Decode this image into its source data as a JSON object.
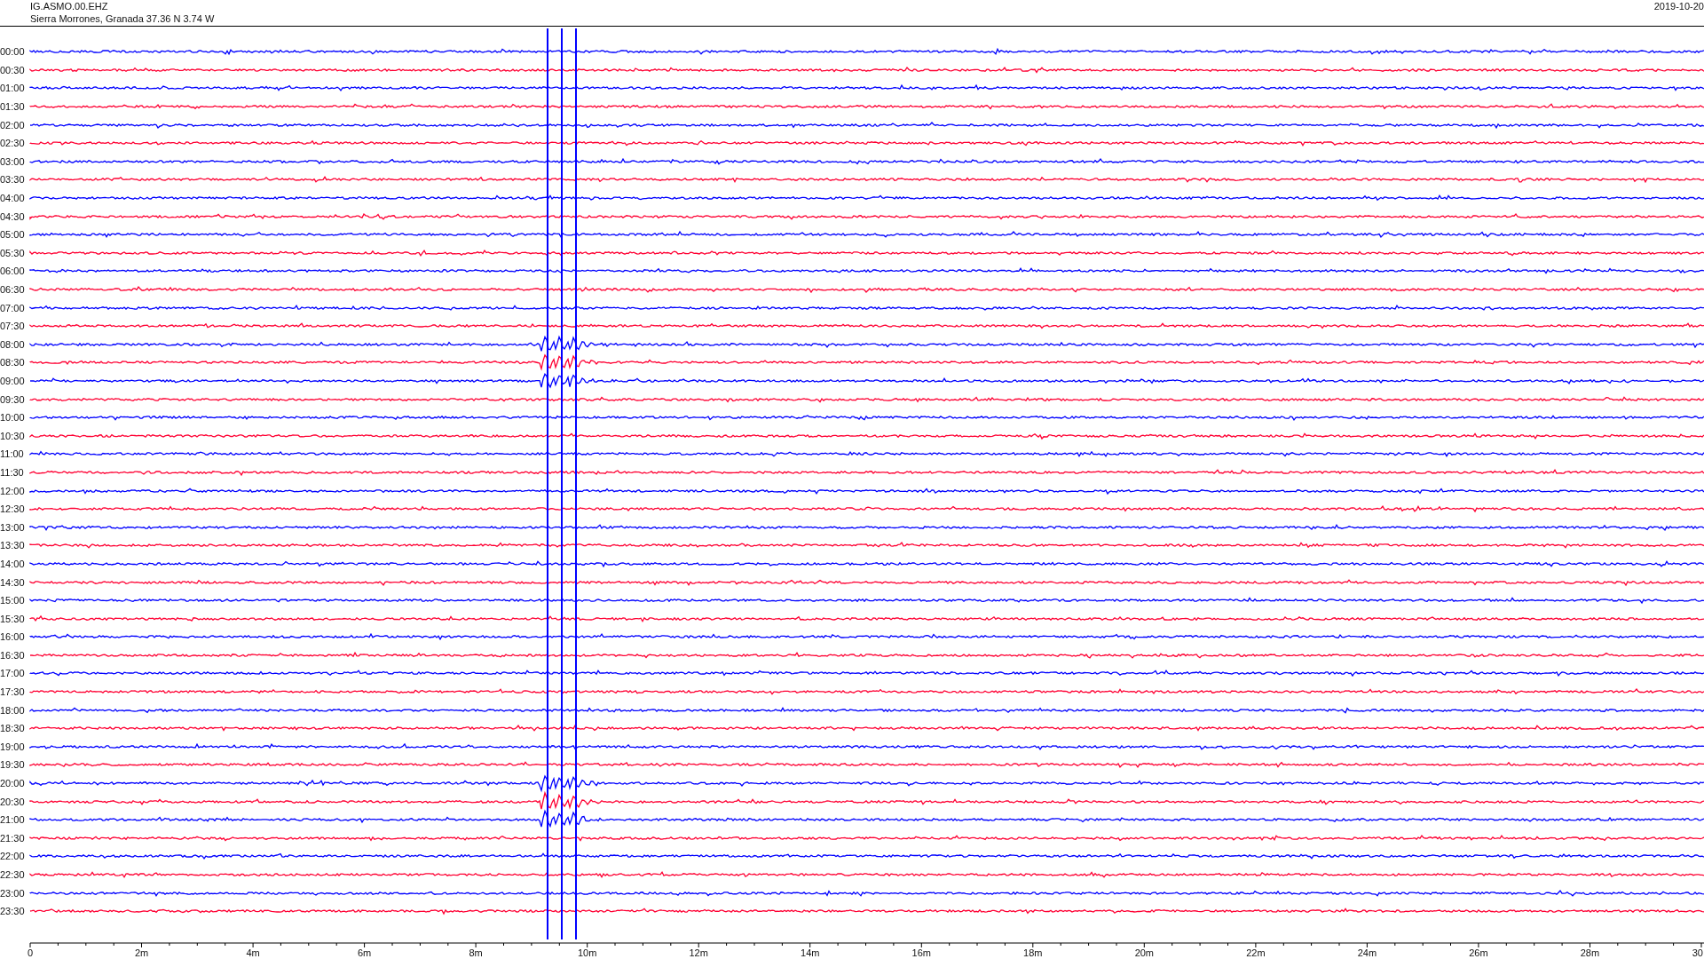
{
  "header": {
    "station": "IG.ASMO.00.EHZ",
    "location": "Sierra Morrones, Granada  37.36 N 3.74 W",
    "date": "2019-10-20"
  },
  "rows": [
    {
      "time": "00:00",
      "color": "#0000ff"
    },
    {
      "time": "00:30",
      "color": "#ff0033"
    },
    {
      "time": "01:00",
      "color": "#0000ff"
    },
    {
      "time": "01:30",
      "color": "#ff0033"
    },
    {
      "time": "02:00",
      "color": "#0000ff"
    },
    {
      "time": "02:30",
      "color": "#ff0033"
    },
    {
      "time": "03:00",
      "color": "#0000ff"
    },
    {
      "time": "03:30",
      "color": "#ff0033"
    },
    {
      "time": "04:00",
      "color": "#0000ff"
    },
    {
      "time": "04:30",
      "color": "#ff0033"
    },
    {
      "time": "05:00",
      "color": "#0000ff"
    },
    {
      "time": "05:30",
      "color": "#ff0033"
    },
    {
      "time": "06:00",
      "color": "#0000ff"
    },
    {
      "time": "06:30",
      "color": "#ff0033"
    },
    {
      "time": "07:00",
      "color": "#0000ff"
    },
    {
      "time": "07:30",
      "color": "#ff0033"
    },
    {
      "time": "08:00",
      "color": "#0000ff"
    },
    {
      "time": "08:30",
      "color": "#ff0033"
    },
    {
      "time": "09:00",
      "color": "#0000ff"
    },
    {
      "time": "09:30",
      "color": "#ff0033"
    },
    {
      "time": "10:00",
      "color": "#0000ff"
    },
    {
      "time": "10:30",
      "color": "#ff0033"
    },
    {
      "time": "11:00",
      "color": "#0000ff"
    },
    {
      "time": "11:30",
      "color": "#ff0033"
    },
    {
      "time": "12:00",
      "color": "#0000ff"
    },
    {
      "time": "12:30",
      "color": "#ff0033"
    },
    {
      "time": "13:00",
      "color": "#0000ff"
    },
    {
      "time": "13:30",
      "color": "#ff0033"
    },
    {
      "time": "14:00",
      "color": "#0000ff"
    },
    {
      "time": "14:30",
      "color": "#ff0033"
    },
    {
      "time": "15:00",
      "color": "#0000ff"
    },
    {
      "time": "15:30",
      "color": "#ff0033"
    },
    {
      "time": "16:00",
      "color": "#0000ff"
    },
    {
      "time": "16:30",
      "color": "#ff0033"
    },
    {
      "time": "17:00",
      "color": "#0000ff"
    },
    {
      "time": "17:30",
      "color": "#ff0033"
    },
    {
      "time": "18:00",
      "color": "#0000ff"
    },
    {
      "time": "18:30",
      "color": "#ff0033"
    },
    {
      "time": "19:00",
      "color": "#0000ff"
    },
    {
      "time": "19:30",
      "color": "#ff0033"
    },
    {
      "time": "20:00",
      "color": "#0000ff"
    },
    {
      "time": "20:30",
      "color": "#ff0033"
    },
    {
      "time": "21:00",
      "color": "#0000ff"
    },
    {
      "time": "21:30",
      "color": "#ff0033"
    },
    {
      "time": "22:00",
      "color": "#0000ff"
    },
    {
      "time": "22:30",
      "color": "#ff0033"
    },
    {
      "time": "23:00",
      "color": "#0000ff"
    },
    {
      "time": "23:30",
      "color": "#ff0033"
    }
  ],
  "axis": {
    "ticks": [
      "0",
      "2m",
      "4m",
      "6m",
      "8m",
      "10m",
      "12m",
      "14m",
      "16m",
      "18m",
      "20m",
      "22m",
      "24m",
      "26m",
      "28m",
      "30"
    ]
  }
}
